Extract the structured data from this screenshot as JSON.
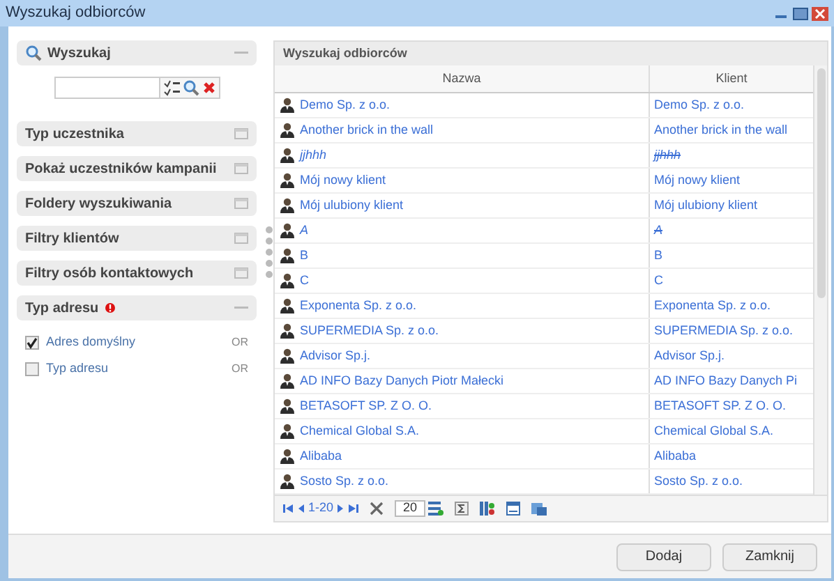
{
  "window": {
    "title": "Wyszukaj odbiorców"
  },
  "search": {
    "title": "Wyszukaj",
    "expanded": true
  },
  "filters": [
    {
      "title": "Typ uczestnika",
      "expanded": false,
      "required": false
    },
    {
      "title": "Pokaż uczestników kampanii",
      "expanded": false,
      "required": false
    },
    {
      "title": "Foldery wyszukiwania",
      "expanded": false,
      "required": false
    },
    {
      "title": "Filtry klientów",
      "expanded": false,
      "required": false
    },
    {
      "title": "Filtry osób kontaktowych",
      "expanded": false,
      "required": false
    },
    {
      "title": "Typ adresu",
      "expanded": true,
      "required": true
    }
  ],
  "address_options": [
    {
      "label": "Adres domyślny",
      "checked": true,
      "operator": "OR"
    },
    {
      "label": "Typ adresu",
      "checked": false,
      "operator": "OR"
    }
  ],
  "grid": {
    "title": "Wyszukaj odbiorców",
    "columns": [
      "Nazwa",
      "Klient"
    ],
    "rows": [
      {
        "name": "Demo Sp. z o.o.",
        "client": "Demo Sp. z o.o.",
        "deleted": false
      },
      {
        "name": "Another brick in the wall",
        "client": "Another brick in the wall",
        "deleted": false
      },
      {
        "name": "jjhhh",
        "client": "jjhhh",
        "deleted": true
      },
      {
        "name": "Mój nowy klient",
        "client": "Mój nowy klient",
        "deleted": false
      },
      {
        "name": "Mój ulubiony klient",
        "client": "Mój ulubiony klient",
        "deleted": false
      },
      {
        "name": "A",
        "client": "A",
        "deleted": true
      },
      {
        "name": "B",
        "client": "B",
        "deleted": false
      },
      {
        "name": "C",
        "client": "C",
        "deleted": false
      },
      {
        "name": "Exponenta Sp. z o.o.",
        "client": "Exponenta Sp. z o.o.",
        "deleted": false
      },
      {
        "name": "SUPERMEDIA Sp. z o.o.",
        "client": "SUPERMEDIA Sp. z o.o.",
        "deleted": false
      },
      {
        "name": "Advisor Sp.j.",
        "client": "Advisor Sp.j.",
        "deleted": false
      },
      {
        "name": "AD INFO Bazy Danych Piotr Małecki",
        "client": "AD INFO Bazy Danych Pi",
        "deleted": false
      },
      {
        "name": "BETASOFT SP. Z O. O.",
        "client": "BETASOFT SP. Z O. O.",
        "deleted": false
      },
      {
        "name": "Chemical Global S.A.",
        "client": "Chemical Global S.A.",
        "deleted": false
      },
      {
        "name": "Alibaba",
        "client": "Alibaba",
        "deleted": false
      },
      {
        "name": "Sosto Sp. z o.o.",
        "client": "Sosto Sp. z o.o.",
        "deleted": false
      }
    ],
    "pager": {
      "range": "1-20",
      "page_size": "20"
    }
  },
  "buttons": [
    "Dodaj",
    "Zamknij"
  ]
}
